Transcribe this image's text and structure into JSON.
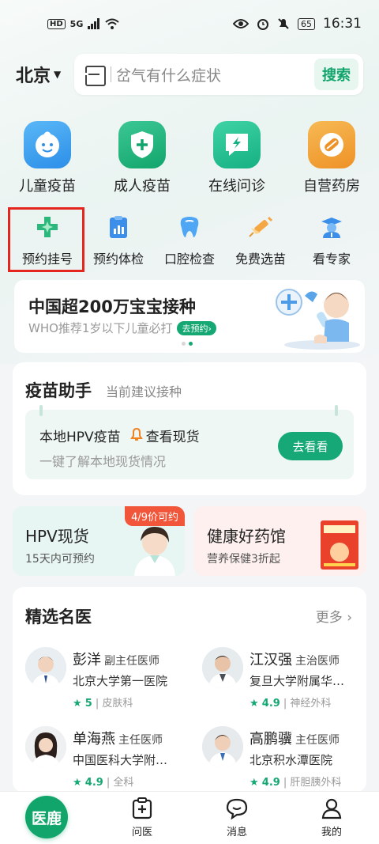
{
  "status_bar": {
    "hd": "HD",
    "network": "5G",
    "battery": "65",
    "time": "16:31"
  },
  "header": {
    "city": "北京",
    "search_placeholder": "岔气有什么症状",
    "search_button": "搜索"
  },
  "main_services": [
    {
      "label": "儿童疫苗",
      "icon": "baby-face-icon",
      "color": "#3aa0f0"
    },
    {
      "label": "成人疫苗",
      "icon": "shield-plus-icon",
      "color": "#19b37e"
    },
    {
      "label": "在线问诊",
      "icon": "chat-lightning-icon",
      "color": "#1dbf8e"
    },
    {
      "label": "自营药房",
      "icon": "pill-icon",
      "color": "#f2a23a"
    }
  ],
  "sub_services": [
    {
      "label": "预约挂号",
      "icon": "register-cross-icon"
    },
    {
      "label": "预约体检",
      "icon": "clipboard-chart-icon"
    },
    {
      "label": "口腔检查",
      "icon": "tooth-icon"
    },
    {
      "label": "免费选苗",
      "icon": "syringe-icon"
    },
    {
      "label": "看专家",
      "icon": "doctor-cap-icon"
    }
  ],
  "banner": {
    "title": "中国超200万宝宝接种",
    "subtitle": "WHO推荐1岁以下儿童必打",
    "pill": "去预约"
  },
  "vaccine_assistant": {
    "title": "疫苗助手",
    "subtitle": "当前建议接种",
    "item_title": "本地HPV疫苗",
    "item_link": "查看现货",
    "item_desc": "一键了解本地现货情况",
    "button": "去看看"
  },
  "promos": {
    "hpv": {
      "title": "HPV现货",
      "subtitle": "15天内可预约",
      "tag": "4/9价可约"
    },
    "drug": {
      "title": "健康好药馆",
      "subtitle": "营养保健3折起"
    }
  },
  "doctors": {
    "title": "精选名医",
    "more": "更多",
    "list": [
      {
        "name": "彭洋",
        "title": "副主任医师",
        "hospital": "北京大学第一医院",
        "rating": "5",
        "dept": "皮肤科"
      },
      {
        "name": "江汉强",
        "title": "主治医师",
        "hospital": "复旦大学附属华…",
        "rating": "4.9",
        "dept": "神经外科"
      },
      {
        "name": "单海燕",
        "title": "主任医师",
        "hospital": "中国医科大学附…",
        "rating": "4.9",
        "dept": "全科"
      },
      {
        "name": "高鹏骥",
        "title": "主任医师",
        "hospital": "北京积水潭医院",
        "rating": "4.9",
        "dept": "肝胆胰外科"
      }
    ]
  },
  "tabbar": {
    "home": "医鹿",
    "tabs": [
      {
        "label": "问医",
        "icon": "medical-clipboard-icon"
      },
      {
        "label": "消息",
        "icon": "chat-bubble-icon"
      },
      {
        "label": "我的",
        "icon": "person-icon"
      }
    ]
  }
}
